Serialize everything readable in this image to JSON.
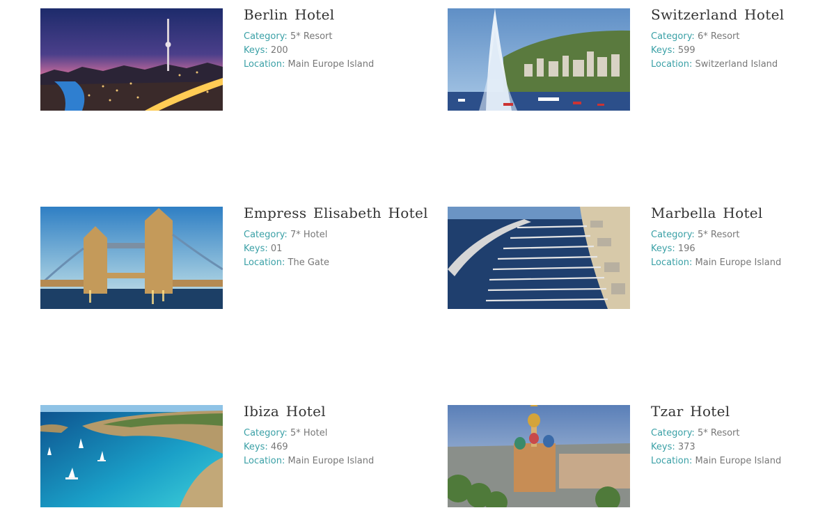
{
  "labels": {
    "category": "Category:",
    "keys": "Keys:",
    "location": "Location:"
  },
  "hotels": [
    {
      "title": "Berlin Hotel",
      "category": "5* Resort",
      "keys": "200",
      "location": "Main Europe Island",
      "image": "berlin-skyline-night"
    },
    {
      "title": "Switzerland Hotel",
      "category": "6* Resort",
      "keys": "599",
      "location": "Switzerland Island",
      "image": "lake-fountain-city"
    },
    {
      "title": "Empress Elisabeth Hotel",
      "category": "7* Hotel",
      "keys": "01",
      "location": "The Gate",
      "image": "tower-bridge"
    },
    {
      "title": "Marbella Hotel",
      "category": "5* Resort",
      "keys": "196",
      "location": "Main Europe Island",
      "image": "marina-aerial"
    },
    {
      "title": "Ibiza Hotel",
      "category": "5* Hotel",
      "keys": "469",
      "location": "Main Europe Island",
      "image": "turquoise-bay"
    },
    {
      "title": "Tzar Hotel",
      "category": "5* Resort",
      "keys": "373",
      "location": "Main Europe Island",
      "image": "onion-dome-cathedral"
    }
  ],
  "colors": {
    "label": "#3aa0a6",
    "value": "#777777",
    "title": "#333333"
  }
}
